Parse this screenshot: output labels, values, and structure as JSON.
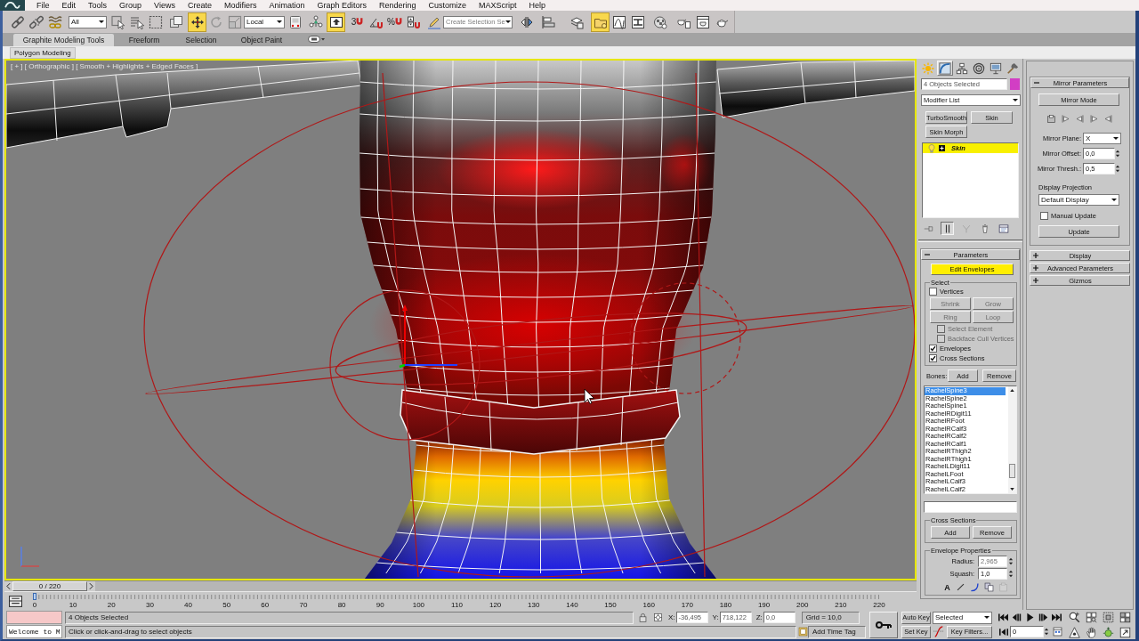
{
  "menu_bar": [
    "File",
    "Edit",
    "Tools",
    "Group",
    "Views",
    "Create",
    "Modifiers",
    "Animation",
    "Graph Editors",
    "Rendering",
    "Customize",
    "MAXScript",
    "Help"
  ],
  "main_toolbar": [
    {
      "kind": "button",
      "active": false
    },
    {
      "kind": "button",
      "active": false
    },
    {
      "kind": "button",
      "active": false
    },
    {
      "kind": "dropdown",
      "value": "All"
    },
    {
      "kind": "button",
      "active": false
    },
    {
      "kind": "button",
      "active": false
    },
    {
      "kind": "button",
      "active": false
    },
    {
      "kind": "button",
      "active": false
    },
    {
      "kind": "button",
      "active": true
    },
    {
      "kind": "button",
      "active": false
    },
    {
      "kind": "button",
      "active": false
    },
    {
      "kind": "dropdown",
      "value": "Local"
    },
    {
      "kind": "button",
      "active": false
    },
    {
      "kind": "button",
      "active": false
    },
    {
      "kind": "button",
      "active": true
    },
    {
      "kind": "button",
      "active": false,
      "label": "3"
    },
    {
      "kind": "button",
      "active": false
    },
    {
      "kind": "button",
      "active": false,
      "label": "%"
    },
    {
      "kind": "button",
      "active": false
    },
    {
      "kind": "button",
      "active": false
    },
    {
      "kind": "combo",
      "placeholder": "Create Selection Se"
    },
    {
      "kind": "button",
      "active": false
    },
    {
      "kind": "button",
      "active": false
    },
    {
      "kind": "button",
      "active": false
    },
    {
      "kind": "button",
      "active": true
    },
    {
      "kind": "button",
      "active": false
    },
    {
      "kind": "button",
      "active": false
    },
    {
      "kind": "button",
      "active": false
    },
    {
      "kind": "button",
      "active": false
    },
    {
      "kind": "button",
      "active": false
    },
    {
      "kind": "button",
      "active": false
    }
  ],
  "ribbon": {
    "tabs": [
      {
        "label": "Graphite Modeling Tools",
        "selected": true
      },
      {
        "label": "Freeform",
        "selected": false
      },
      {
        "label": "Selection",
        "selected": false
      },
      {
        "label": "Object Paint",
        "selected": false
      }
    ],
    "panel": "Polygon Modeling"
  },
  "viewport": {
    "label": "[ + ] [ Orthographic ] [ Smooth + Highlights + Edged Faces ]"
  },
  "command_panel": {
    "tabs": [
      {
        "selected": false
      },
      {
        "selected": true
      },
      {
        "selected": false
      },
      {
        "selected": false
      },
      {
        "selected": false
      },
      {
        "selected": false
      }
    ],
    "selection_name": "4 Objects Selected",
    "modifier_list": "Modifier List",
    "modifier_buttons": [
      "TurboSmooth",
      "Skin",
      "Skin Morph"
    ],
    "stack": [
      {
        "label": "Skin",
        "selected": true
      }
    ],
    "stack_tools": [
      {
        "active": false
      },
      {
        "active": true
      },
      {
        "active": false
      },
      {
        "active": false
      },
      {
        "active": false
      }
    ],
    "parameters": {
      "title": "Parameters",
      "expanded": true,
      "edit_envelopes": {
        "label": "Edit Envelopes",
        "active": true
      },
      "select": {
        "title": "Select",
        "items": [
          {
            "kind": "check",
            "label": "Vertices",
            "checked": false,
            "disabled": false
          },
          {
            "kind": "buttons",
            "buttons": [
              {
                "label": "Shrink",
                "disabled": true
              },
              {
                "label": "Grow",
                "disabled": true
              }
            ]
          },
          {
            "kind": "buttons",
            "buttons": [
              {
                "label": "Ring",
                "disabled": true
              },
              {
                "label": "Loop",
                "disabled": true
              }
            ]
          },
          {
            "kind": "subcheck",
            "label": "Select Element",
            "checked": false,
            "disabled": true
          },
          {
            "kind": "subcheck",
            "label": "Backface Cull Vertices",
            "checked": false,
            "disabled": true
          },
          {
            "kind": "check",
            "label": "Envelopes",
            "checked": true,
            "disabled": false
          },
          {
            "kind": "check",
            "label": "Cross Sections",
            "checked": true,
            "disabled": false
          }
        ]
      },
      "bones": {
        "label": "Bones:",
        "add": "Add",
        "remove": "Remove",
        "list": [
          {
            "label": "RachelSpine3",
            "selected": true
          },
          {
            "label": "RachelSpine2",
            "selected": false
          },
          {
            "label": "RachelSpine1",
            "selected": false
          },
          {
            "label": "RachelRDigit11",
            "selected": false
          },
          {
            "label": "RachelRFoot",
            "selected": false
          },
          {
            "label": "RachelRCalf3",
            "selected": false
          },
          {
            "label": "RachelRCalf2",
            "selected": false
          },
          {
            "label": "RachelRCalf1",
            "selected": false
          },
          {
            "label": "RachelRThigh2",
            "selected": false
          },
          {
            "label": "RachelRThigh1",
            "selected": false
          },
          {
            "label": "RachelLDigit11",
            "selected": false
          },
          {
            "label": "RachelLFoot",
            "selected": false
          },
          {
            "label": "RachelLCalf3",
            "selected": false
          },
          {
            "label": "RachelLCalf2",
            "selected": false
          }
        ]
      },
      "cross_sections": {
        "title": "Cross Sections",
        "add": "Add",
        "remove": "Remove"
      },
      "envelope_properties": {
        "title": "Envelope Properties",
        "radius": {
          "label": "Radius:",
          "value": "2,965",
          "disabled": true
        },
        "squash": {
          "label": "Squash:",
          "value": "1,0",
          "disabled": false
        },
        "tools": [
          {
            "label": "A",
            "disabled": false
          },
          {
            "disabled": false
          },
          {
            "disabled": false
          },
          {
            "disabled": false
          },
          {
            "disabled": true
          }
        ]
      }
    },
    "mirror_parameters": {
      "title": "Mirror Parameters",
      "expanded": true,
      "mirror_mode": "Mirror Mode",
      "plane": {
        "label": "Mirror Plane:",
        "value": "X"
      },
      "offset": {
        "label": "Mirror Offset:",
        "value": "0,0"
      },
      "threshold": {
        "label": "Mirror Thresh.:",
        "value": "0,5"
      },
      "projection_label": "Display Projection",
      "projection": "Default Display",
      "manual_update": {
        "label": "Manual Update",
        "checked": false
      },
      "update": "Update"
    },
    "rollouts": [
      {
        "title": "Display",
        "expanded": false
      },
      {
        "title": "Advanced Parameters",
        "expanded": false
      },
      {
        "title": "Gizmos",
        "expanded": false
      }
    ]
  },
  "time_slider": {
    "position": "0 / 220",
    "level": 0
  },
  "track_bar": {
    "labels": [
      "0",
      "10",
      "20",
      "30",
      "40",
      "50",
      "60",
      "70",
      "80",
      "90",
      "100",
      "110",
      "120",
      "130",
      "140",
      "150",
      "160",
      "170",
      "180",
      "190",
      "200",
      "210",
      "220"
    ]
  },
  "status_bar": {
    "listener_output": "Welcome to M",
    "selection": "4 Objects Selected",
    "prompt": "Click or click-and-drag to select objects",
    "coordinates": [
      {
        "label": "X:",
        "value": "-36,495"
      },
      {
        "label": "Y:",
        "value": "718,122"
      },
      {
        "label": "Z:",
        "value": "0,0"
      }
    ],
    "grid": "Grid = 10,0",
    "time_tag": "Add Time Tag"
  },
  "animation_controls": {
    "auto_key": {
      "label": "Auto Key",
      "on": false
    },
    "key_set": "Selected",
    "set_key": "Set Key",
    "key_filters": "Key Filters...",
    "frame": "0"
  }
}
